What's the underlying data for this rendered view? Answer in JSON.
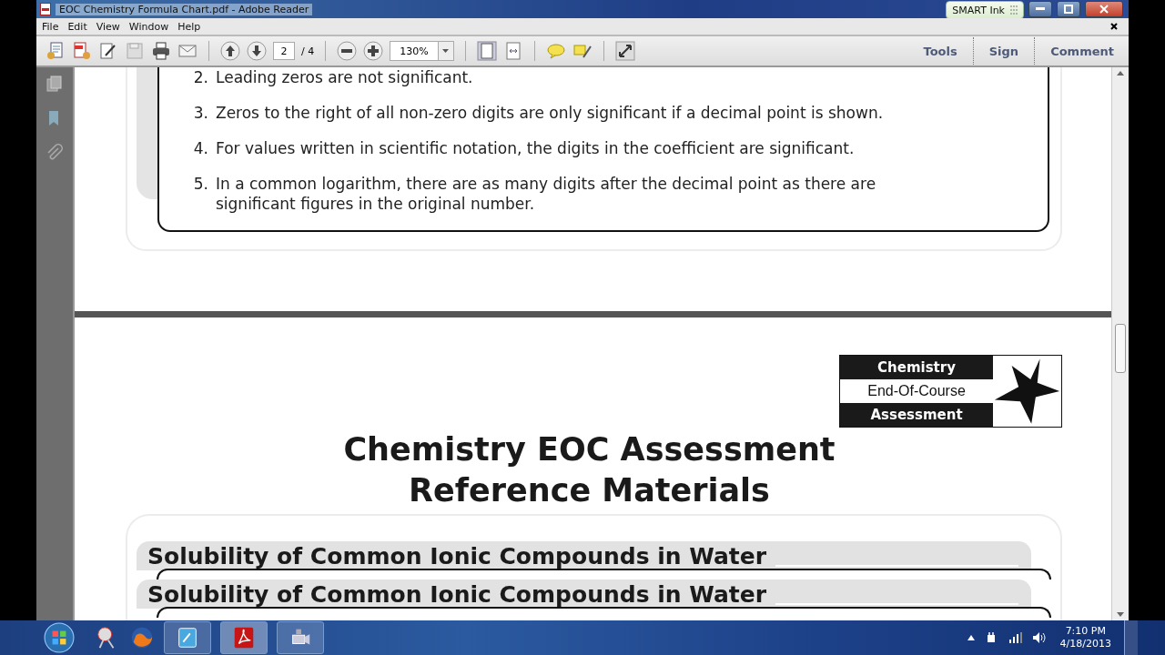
{
  "window": {
    "title": "EOC Chemistry Formula Chart.pdf - Adobe Reader"
  },
  "overlay": {
    "label": "SMART Ink"
  },
  "menu": [
    "File",
    "Edit",
    "View",
    "Window",
    "Help"
  ],
  "toolbar": {
    "page": "2",
    "page_total": "/ 4",
    "zoom": "130%"
  },
  "panel_tabs": [
    "Tools",
    "Sign",
    "Comment"
  ],
  "page_1": {
    "rules": [
      {
        "number": "2.",
        "text": "Leading zeros are not significant."
      },
      {
        "number": "3.",
        "text": "Zeros to the right of all non-zero digits are only significant if a decimal point is shown."
      },
      {
        "number": "4.",
        "text": "For values written in scientific notation, the digits in the coefficient are significant."
      },
      {
        "number": "5.",
        "text": "In a common logarithm, there are as many digits after the decimal point as there are significant figures in the original number."
      }
    ]
  },
  "page_2": {
    "logo": [
      "Chemistry",
      "End-Of-Course",
      "Assessment"
    ],
    "title": [
      "Chemistry EOC Assessment",
      "Reference Materials"
    ],
    "headings": [
      "Solubility of Common Ionic Compounds in Water",
      "Solubility of Common Ionic Compounds in Water"
    ]
  },
  "taskbar": {
    "time": "7:10 PM",
    "date": "4/18/2013"
  }
}
